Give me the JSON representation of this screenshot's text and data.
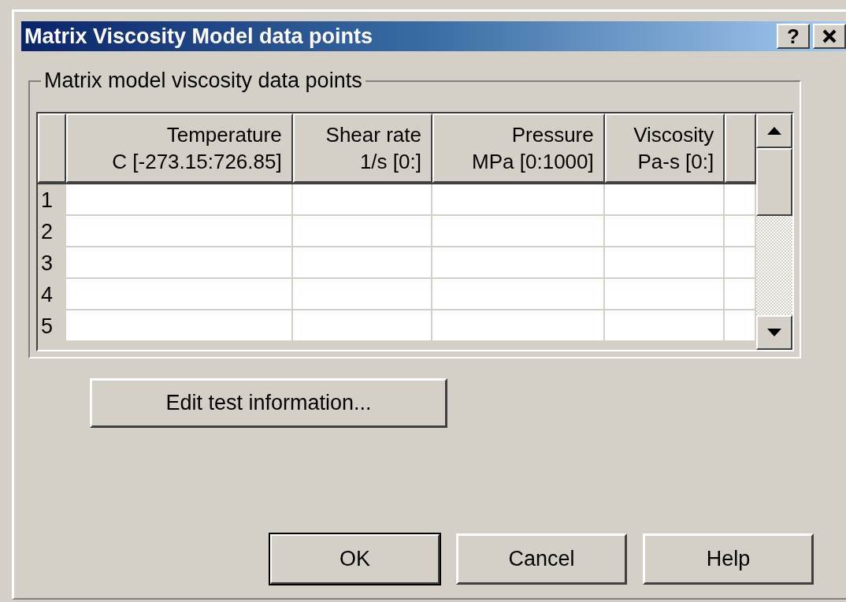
{
  "window": {
    "title": "Matrix Viscosity Model data points",
    "help_button": "?"
  },
  "group": {
    "label": "Matrix model viscosity data points"
  },
  "table": {
    "columns": [
      {
        "name": "Temperature",
        "unit": "C [-273.15:726.85]"
      },
      {
        "name": "Shear rate",
        "unit": "1/s [0:]"
      },
      {
        "name": "Pressure",
        "unit": "MPa [0:1000]"
      },
      {
        "name": "Viscosity",
        "unit": "Pa-s [0:]"
      }
    ],
    "rows": [
      {
        "number": "1"
      },
      {
        "number": "2"
      },
      {
        "number": "3"
      },
      {
        "number": "4"
      },
      {
        "number": "5"
      }
    ]
  },
  "edit_button": "Edit test information...",
  "buttons": [
    {
      "label": "OK",
      "default": true
    },
    {
      "label": "Cancel",
      "default": false
    },
    {
      "label": "Help",
      "default": false
    }
  ]
}
